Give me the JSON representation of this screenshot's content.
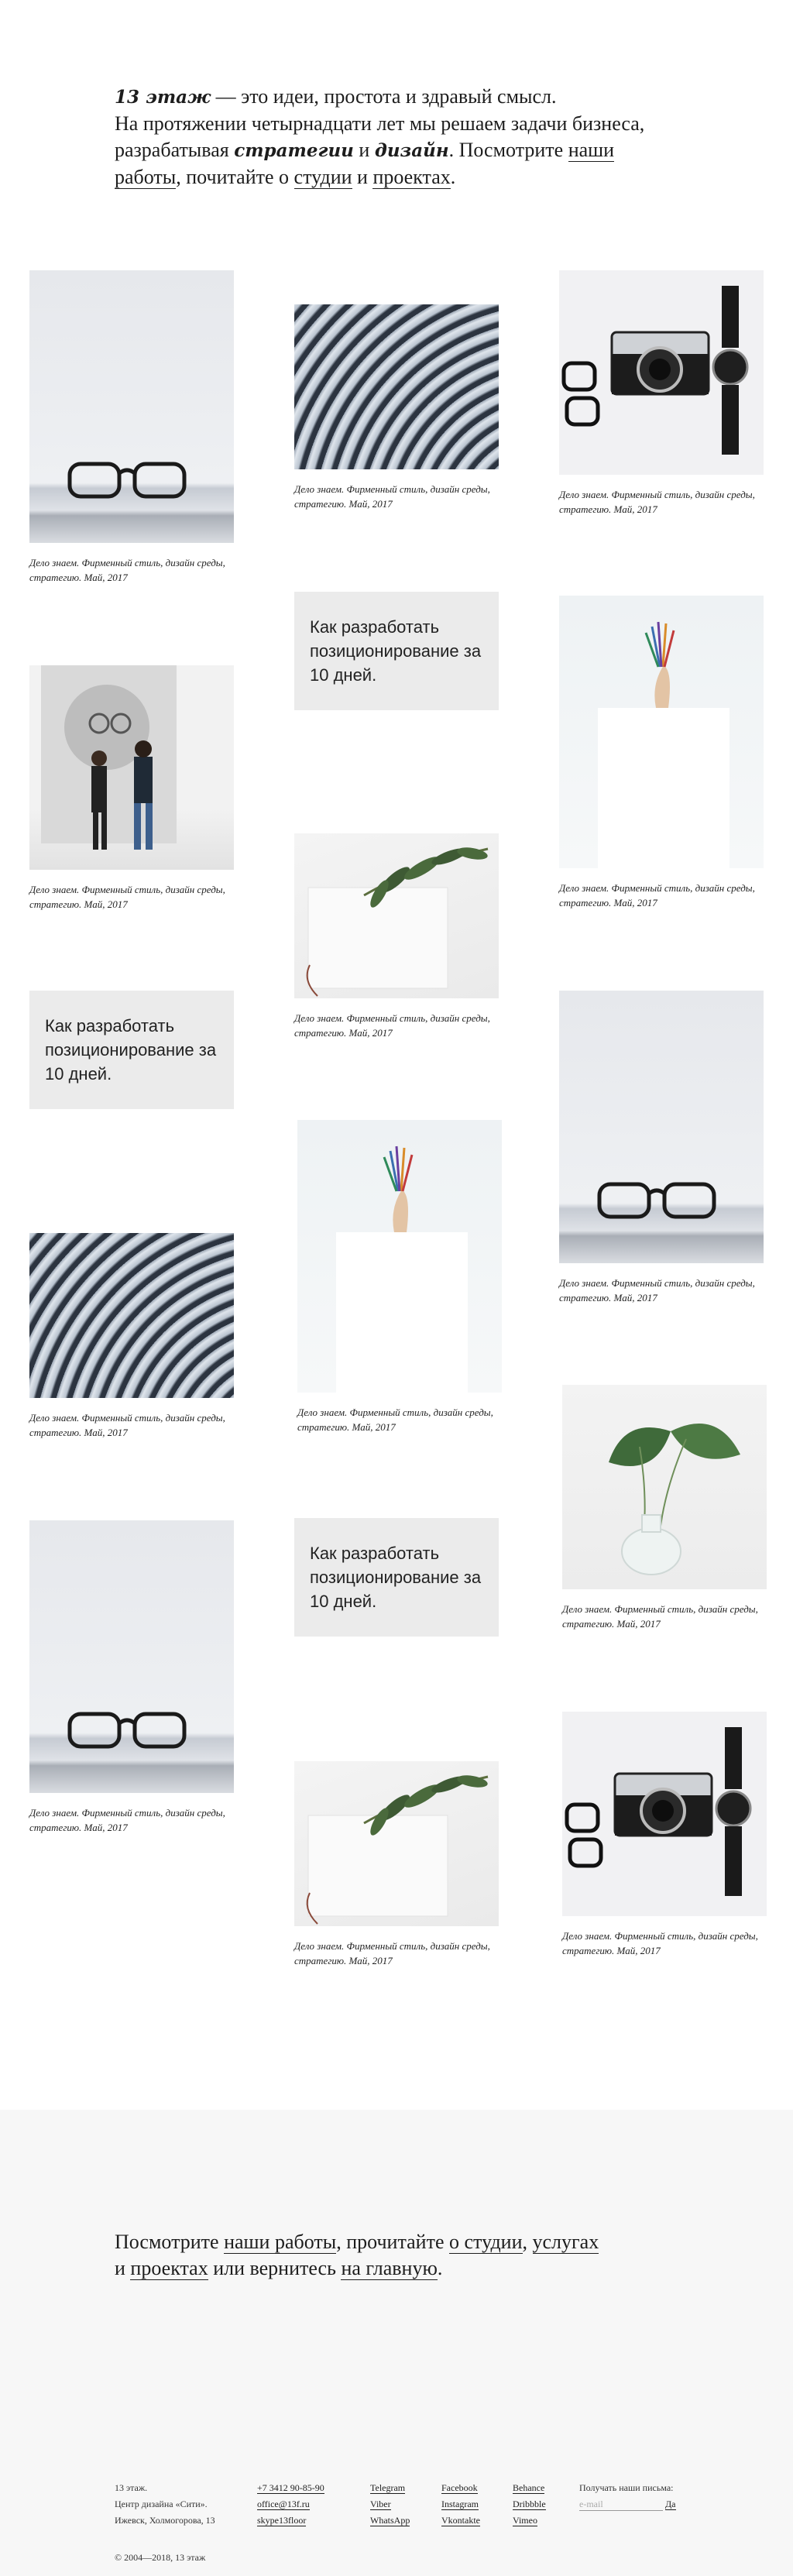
{
  "intro": {
    "brand": "13 этаж",
    "dash": " — это идеи, простота и здравый смысл.",
    "line2": "На протяжении четырнадцати лет мы решаем задачи бизнеса, разрабатывая ",
    "strategies": "стратегии",
    "and": " и ",
    "design": "дизайн",
    "look": ". Посмотрите ",
    "works_link": "наши работы",
    "read": ", почитайте о ",
    "studio_link": "студии",
    "and2": " и ",
    "projects_link": "проектах",
    "end": "."
  },
  "caption": "Дело знаем. Фирменный стиль, дизайн среды, стратегию. Май, 2017",
  "text_card": "Как разработать позиционирование за 10 дней.",
  "bottom": {
    "p1": "Посмотрите ",
    "works_link": "наши работы",
    "p2": ", прочитайте ",
    "studio_link": "о студии",
    "p3": ", ",
    "services_link": "услугах",
    "p4": " и ",
    "projects_link": "проектах",
    "p5": " или вернитесь ",
    "home_link": "на главную",
    "p6": "."
  },
  "footer": {
    "address": [
      "13 этаж.",
      "Центр дизайна «Сити».",
      "Ижевск, Холмогорова, 13"
    ],
    "contacts": [
      "+7 3412 90-85-90",
      "office@13f.ru",
      "skype13floor"
    ],
    "social1": [
      "Telegram",
      "Viber",
      "WhatsApp"
    ],
    "social2": [
      "Facebook",
      "Instagram",
      "Vkontakte"
    ],
    "social3": [
      "Behance",
      "Dribbble",
      "Vimeo"
    ],
    "newsletter_label": "Получать наши письма:",
    "email_placeholder": "e-mail",
    "yes_label": "Да",
    "copyright": "© 2004—2018, 13 этаж"
  }
}
